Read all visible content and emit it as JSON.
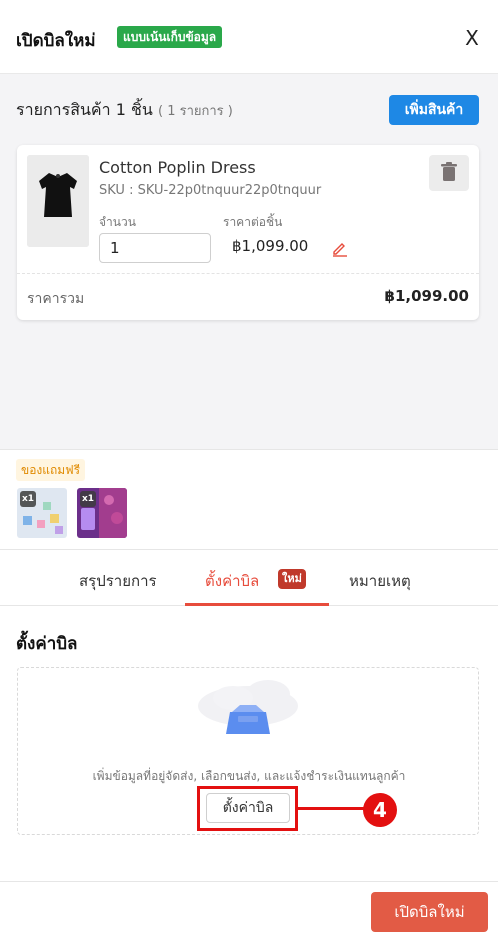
{
  "header": {
    "title": "เปิดบิลใหม่",
    "mode_badge": "แบบเน้นเก็บข้อมูล",
    "close_label": "X"
  },
  "items": {
    "title": "รายการสินค้า 1 ชิ้น",
    "count": "( 1 รายการ )",
    "add_button": "เพิ่มสินค้า"
  },
  "product": {
    "name": "Cotton Poplin Dress",
    "sku": "SKU : SKU-22p0tnquur22p0tnquur",
    "qty_label": "จำนวน",
    "qty_value": "1",
    "price_label": "ราคาต่อชิ้น",
    "price_value": "฿1,099.00",
    "total_label": "ราคารวม",
    "total_value": "฿1,099.00"
  },
  "gifts": {
    "tag": "ของแถมฟรี",
    "items": [
      {
        "qty": "x1"
      },
      {
        "qty": "x1"
      }
    ]
  },
  "tabs": [
    {
      "label": "สรุปรายการ"
    },
    {
      "label": "ตั้งค่าบิล",
      "badge": "ใหม่",
      "active": true
    },
    {
      "label": "หมายเหตุ"
    }
  ],
  "bill_settings": {
    "title": "ตั้งค่าบิล",
    "empty_text": "เพิ่มข้อมูลที่อยู่จัดส่ง, เลือกขนส่ง, และแจ้งชำระเงินแทนลูกค้า",
    "setup_button": "ตั้งค่าบิล"
  },
  "annotation": {
    "step_number": "4"
  },
  "footer": {
    "primary_button": "เปิดบิลใหม่"
  },
  "colors": {
    "primary_blue": "#1e88e5",
    "badge_green": "#2aa84a",
    "accent_red": "#e74c3c",
    "callout_red": "#e31010",
    "footer_button": "#e25b45"
  }
}
